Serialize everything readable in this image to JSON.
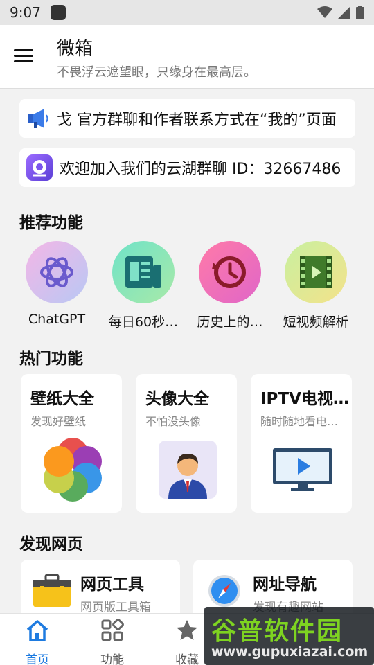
{
  "status_bar": {
    "time": "9:07"
  },
  "app_bar": {
    "title": "微箱",
    "subtitle": "不畏浮云遮望眼，只缘身在最高层。"
  },
  "notices": [
    {
      "text": "戈    官方群聊和作者联系方式在“我的”页面"
    },
    {
      "text": "欢迎加入我们的云湖群聊 ID：32667486"
    }
  ],
  "recommended": {
    "title": "推荐功能",
    "items": [
      {
        "label": "ChatGPT",
        "icon": "chatgpt-icon"
      },
      {
        "label": "每日60秒…",
        "icon": "newspaper-icon"
      },
      {
        "label": "历史上的…",
        "icon": "history-icon"
      },
      {
        "label": "短视频解析",
        "icon": "video-icon"
      }
    ]
  },
  "hot": {
    "title": "热门功能",
    "items": [
      {
        "title": "壁纸大全",
        "subtitle": "发现好壁纸",
        "icon": "wallpaper-icon"
      },
      {
        "title": "头像大全",
        "subtitle": "不怕没头像",
        "icon": "avatar-icon"
      },
      {
        "title": "IPTV电视…",
        "subtitle": "随时随地看电…",
        "icon": "tv-icon"
      }
    ]
  },
  "discover": {
    "title": "发现网页",
    "items": [
      {
        "title": "网页工具",
        "subtitle": "网页版工具箱",
        "icon": "toolbox-icon"
      },
      {
        "title": "网址导航",
        "subtitle": "发现有趣网站",
        "icon": "compass-icon"
      }
    ]
  },
  "bottom_nav": {
    "items": [
      {
        "label": "首页",
        "icon": "home-icon",
        "active": true
      },
      {
        "label": "功能",
        "icon": "grid-icon",
        "active": false
      },
      {
        "label": "收藏",
        "icon": "star-icon",
        "active": false
      }
    ]
  },
  "watermark": {
    "title": "谷普软件园",
    "url": "www.gupuxiazai.com"
  },
  "colors": {
    "accent": "#1e7be0",
    "background": "#f2f2f2"
  }
}
